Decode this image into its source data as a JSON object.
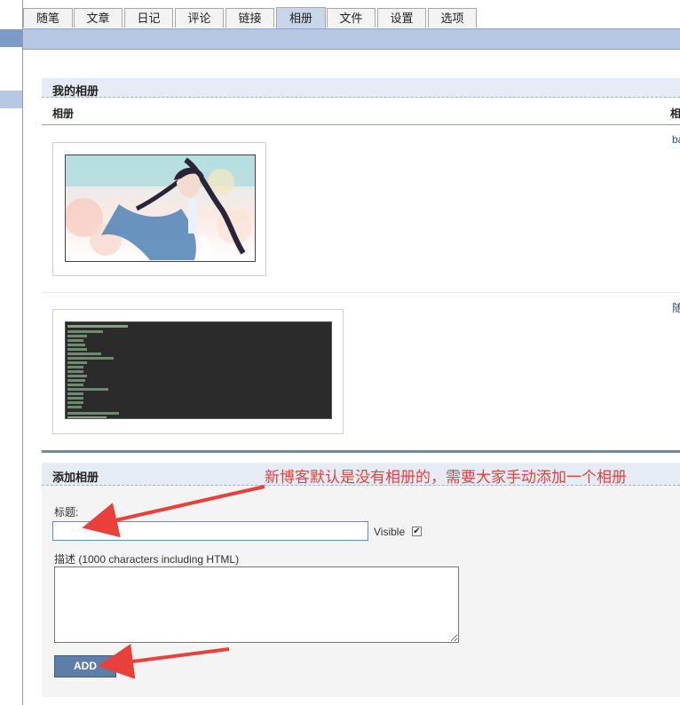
{
  "tabs": [
    {
      "label": "随笔"
    },
    {
      "label": "文章"
    },
    {
      "label": "日记"
    },
    {
      "label": "评论"
    },
    {
      "label": "链接"
    },
    {
      "label": "相册",
      "active": true
    },
    {
      "label": "文件"
    },
    {
      "label": "设置"
    },
    {
      "label": "选项"
    }
  ],
  "albums": {
    "section_title": "我的相册",
    "column_album": "相册",
    "column_right": "相",
    "rows": [
      {
        "right_text": "ba"
      },
      {
        "right_text": "随"
      }
    ]
  },
  "add_album": {
    "section_title": "添加相册",
    "title_label": "标题:",
    "title_value": "",
    "visible_label": "Visible",
    "visible_checked": true,
    "description_label": "描述 (1000 characters including HTML)",
    "description_value": "",
    "add_button": "ADD"
  },
  "annotation": {
    "text": "新博客默认是没有相册的，需要大家手动添加一个相册",
    "color": "#e8403a"
  },
  "colors": {
    "active_tab": "#c9d5e8",
    "nav_band": "#b7c8e4",
    "button": "#5e7ea8"
  }
}
